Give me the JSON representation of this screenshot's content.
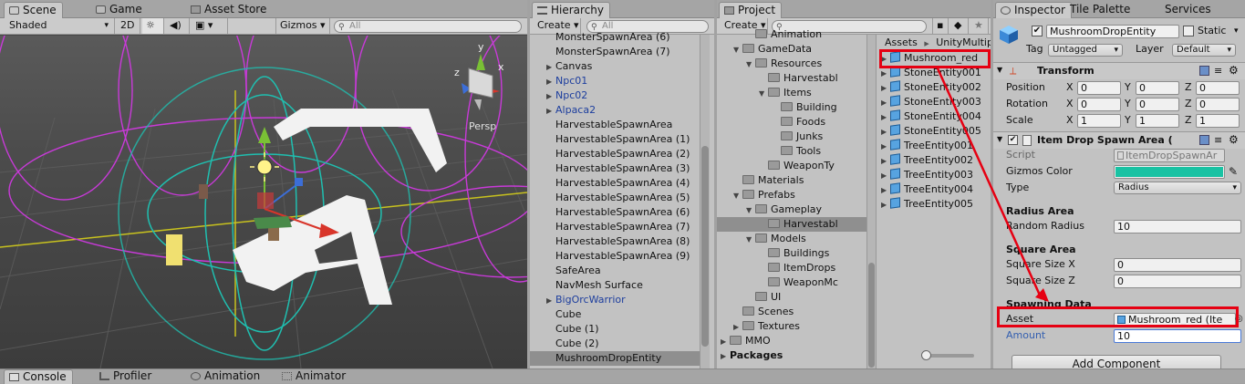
{
  "colors": {
    "accent": "#e60012",
    "gizmos_color": "#19c2a3",
    "prefab_blue": "#1d3e9e",
    "selection": "#8f8f8f"
  },
  "scene": {
    "tabs": [
      {
        "label": "Scene",
        "icon": "scene-icon"
      },
      {
        "label": "Game",
        "icon": "game-icon"
      },
      {
        "label": "Asset Store",
        "icon": "store-icon"
      }
    ],
    "toolbar": {
      "shading": "Shaded",
      "mode_2d": "2D",
      "gizmos": "Gizmos",
      "search_placeholder": "All"
    },
    "persp_label": "Persp",
    "axis_labels": {
      "y": "y",
      "x": "x",
      "z": "z"
    }
  },
  "hierarchy": {
    "tab": "Hierarchy",
    "create": "Create",
    "search_placeholder": "All",
    "items": [
      {
        "label": "MonsterSpawnArea (6)",
        "arrow": "",
        "blue": false
      },
      {
        "label": "MonsterSpawnArea (7)",
        "arrow": "",
        "blue": false
      },
      {
        "label": "Canvas",
        "arrow": "▶",
        "blue": false
      },
      {
        "label": "Npc01",
        "arrow": "▶",
        "blue": true
      },
      {
        "label": "Npc02",
        "arrow": "▶",
        "blue": true
      },
      {
        "label": "Alpaca2",
        "arrow": "▶",
        "blue": true
      },
      {
        "label": "HarvestableSpawnArea",
        "arrow": "",
        "blue": false
      },
      {
        "label": "HarvestableSpawnArea (1)",
        "arrow": "",
        "blue": false
      },
      {
        "label": "HarvestableSpawnArea (2)",
        "arrow": "",
        "blue": false
      },
      {
        "label": "HarvestableSpawnArea (3)",
        "arrow": "",
        "blue": false
      },
      {
        "label": "HarvestableSpawnArea (4)",
        "arrow": "",
        "blue": false
      },
      {
        "label": "HarvestableSpawnArea (5)",
        "arrow": "",
        "blue": false
      },
      {
        "label": "HarvestableSpawnArea (6)",
        "arrow": "",
        "blue": false
      },
      {
        "label": "HarvestableSpawnArea (7)",
        "arrow": "",
        "blue": false
      },
      {
        "label": "HarvestableSpawnArea (8)",
        "arrow": "",
        "blue": false
      },
      {
        "label": "HarvestableSpawnArea (9)",
        "arrow": "",
        "blue": false
      },
      {
        "label": "SafeArea",
        "arrow": "",
        "blue": false
      },
      {
        "label": "NavMesh Surface",
        "arrow": "",
        "blue": false
      },
      {
        "label": "BigOrcWarrior",
        "arrow": "▶",
        "blue": true
      },
      {
        "label": "Cube",
        "arrow": "",
        "blue": false
      },
      {
        "label": "Cube (1)",
        "arrow": "",
        "blue": false
      },
      {
        "label": "Cube (2)",
        "arrow": "",
        "blue": false
      },
      {
        "label": "MushroomDropEntity",
        "arrow": "",
        "blue": false,
        "selected": true
      }
    ]
  },
  "project": {
    "tab": "Project",
    "create": "Create",
    "breadcrumb": {
      "root": "Assets",
      "sep": "▶",
      "child": "UnityMultip"
    },
    "tree": [
      {
        "label": "Animation",
        "indent": 2,
        "arrow": ""
      },
      {
        "label": "GameData",
        "indent": 1,
        "arrow": "▼"
      },
      {
        "label": "Resources",
        "indent": 2,
        "arrow": "▼"
      },
      {
        "label": "Harvestabl",
        "indent": 3,
        "arrow": ""
      },
      {
        "label": "Items",
        "indent": 3,
        "arrow": "▼"
      },
      {
        "label": "Building",
        "indent": 4,
        "arrow": ""
      },
      {
        "label": "Foods",
        "indent": 4,
        "arrow": ""
      },
      {
        "label": "Junks",
        "indent": 4,
        "arrow": ""
      },
      {
        "label": "Tools",
        "indent": 4,
        "arrow": ""
      },
      {
        "label": "WeaponTy",
        "indent": 3,
        "arrow": ""
      },
      {
        "label": "Materials",
        "indent": 1,
        "arrow": ""
      },
      {
        "label": "Prefabs",
        "indent": 1,
        "arrow": "▼"
      },
      {
        "label": "Gameplay",
        "indent": 2,
        "arrow": "▼"
      },
      {
        "label": "Harvestabl",
        "indent": 3,
        "arrow": "",
        "selected": true
      },
      {
        "label": "Models",
        "indent": 2,
        "arrow": "▼"
      },
      {
        "label": "Buildings",
        "indent": 3,
        "arrow": ""
      },
      {
        "label": "ItemDrops",
        "indent": 3,
        "arrow": ""
      },
      {
        "label": "WeaponMc",
        "indent": 3,
        "arrow": ""
      },
      {
        "label": "UI",
        "indent": 2,
        "arrow": ""
      },
      {
        "label": "Scenes",
        "indent": 1,
        "arrow": ""
      },
      {
        "label": "Textures",
        "indent": 1,
        "arrow": "▶"
      },
      {
        "label": "MMO",
        "indent": 0,
        "arrow": "▶"
      },
      {
        "label": "Packages",
        "indent": 0,
        "arrow": "▶",
        "bold": true
      }
    ],
    "assets": [
      "Mushroom_red",
      "StoneEntity001",
      "StoneEntity002",
      "StoneEntity003",
      "StoneEntity004",
      "StoneEntity005",
      "TreeEntity001",
      "TreeEntity002",
      "TreeEntity003",
      "TreeEntity004",
      "TreeEntity005"
    ]
  },
  "inspector": {
    "tabs": [
      {
        "label": "Inspector"
      },
      {
        "label": "Tile Palette"
      },
      {
        "label": "Services"
      }
    ],
    "object_name": "MushroomDropEntity",
    "static_label": "Static",
    "tag_label": "Tag",
    "tag_value": "Untagged",
    "layer_label": "Layer",
    "layer_value": "Default",
    "transform": {
      "title": "Transform",
      "rows": [
        {
          "label": "Position",
          "x": "0",
          "y": "0",
          "z": "0"
        },
        {
          "label": "Rotation",
          "x": "0",
          "y": "0",
          "z": "0"
        },
        {
          "label": "Scale",
          "x": "1",
          "y": "1",
          "z": "1"
        }
      ],
      "axis": {
        "x": "X",
        "y": "Y",
        "z": "Z"
      }
    },
    "drop": {
      "title": "Item Drop Spawn Area (",
      "script_label": "Script",
      "script_value": "ItemDropSpawnAr",
      "gizmos_label": "Gizmos Color",
      "type_label": "Type",
      "type_value": "Radius",
      "radius_header": "Radius Area",
      "random_radius_label": "Random Radius",
      "random_radius_value": "10",
      "square_header": "Square Area",
      "sx_label": "Square Size X",
      "sx_value": "0",
      "sz_label": "Square Size Z",
      "sz_value": "0",
      "spawn_header": "Spawning Data",
      "asset_label": "Asset",
      "asset_value": "Mushroom_red (Ite",
      "amount_label": "Amount",
      "amount_value": "10"
    },
    "add_component": "Add Component"
  },
  "bottom_tabs": [
    {
      "label": "Console",
      "icon": "console-icon"
    },
    {
      "label": "Profiler",
      "icon": "profiler-icon"
    },
    {
      "label": "Animation",
      "icon": "animation-icon"
    },
    {
      "label": "Animator",
      "icon": "animator-icon"
    }
  ]
}
